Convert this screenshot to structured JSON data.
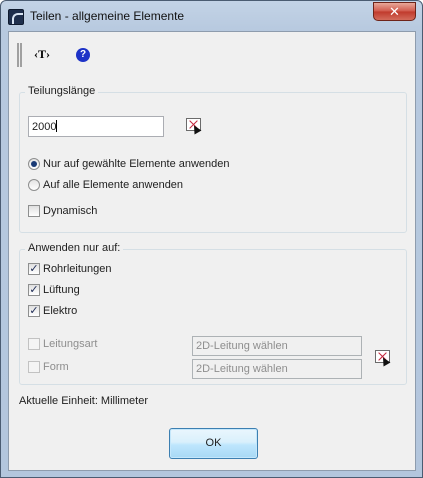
{
  "window": {
    "title": "Teilen - allgemeine Elemente",
    "close_label": "✕"
  },
  "toolbar": {
    "text_tool_label": "‹T›",
    "help_label": "?"
  },
  "division": {
    "group_label": "Teilungslänge",
    "length_value": "2000",
    "apply_selected_label": "Nur auf gewählte Elemente anwenden",
    "apply_selected_checked": true,
    "apply_all_label": "Auf alle Elemente anwenden",
    "apply_all_checked": false,
    "dynamic_label": "Dynamisch",
    "dynamic_checked": false
  },
  "apply_only": {
    "group_label": "Anwenden nur auf:",
    "items": [
      {
        "label": "Rohrleitungen",
        "checked": true
      },
      {
        "label": "Lüftung",
        "checked": true
      },
      {
        "label": "Elektro",
        "checked": true
      }
    ],
    "line_type_label": "Leitungsart",
    "line_type_value": "2D-Leitung wählen",
    "form_label": "Form",
    "form_value": "2D-Leitung wählen"
  },
  "status": {
    "unit_text": "Aktuelle Einheit: Millimeter"
  },
  "ok_label": "OK"
}
